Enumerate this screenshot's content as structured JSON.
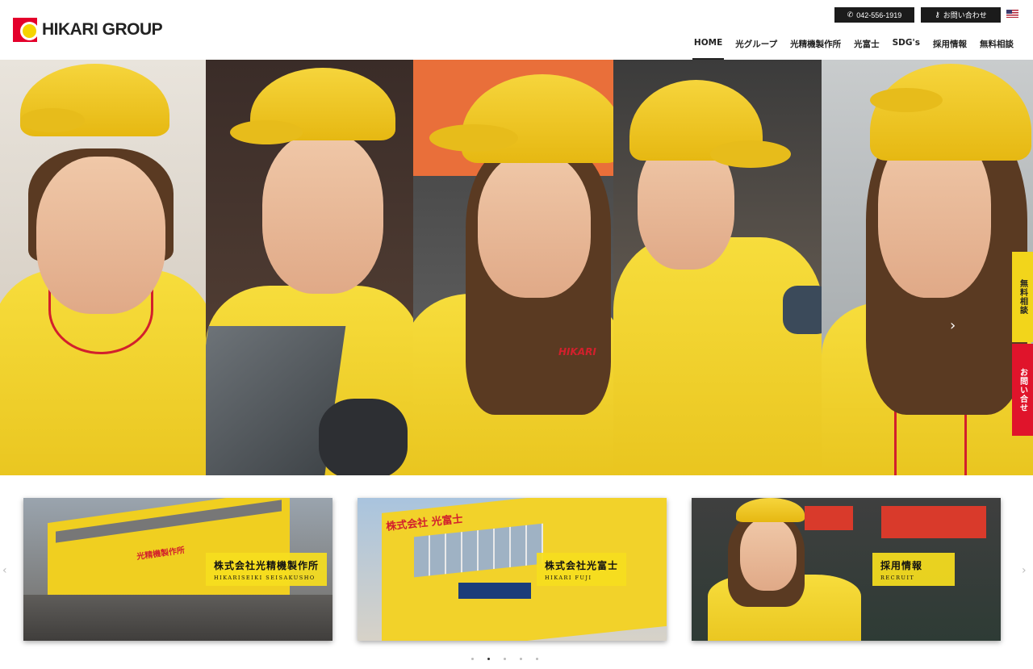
{
  "header": {
    "logo_text": "HIKARI GROUP",
    "phone": "042-556-1919",
    "contact": "お問い合わせ",
    "language_flag": "us-flag-icon",
    "nav": [
      "HOME",
      "光グループ",
      "光精機製作所",
      "光富士",
      "SDG's",
      "採用情報",
      "無料相談"
    ],
    "active_nav": "HOME"
  },
  "hero": {
    "side_tabs": [
      "無料相談",
      "お問い合せ"
    ],
    "slide_count": 6,
    "active_slide": 1,
    "next_icon": "chevron-right-icon",
    "jacket_text": "HIKARI"
  },
  "cards": [
    {
      "title": "株式会社光精機製作所",
      "subtitle": "HIKARISEIKI SEISAKUSHO",
      "sign": "光精機製作所"
    },
    {
      "title": "株式会社光富士",
      "subtitle": "HIKARI FUJI",
      "sign": "株式会社 光富士"
    },
    {
      "title": "採用情報",
      "subtitle": "RECRUIT"
    }
  ],
  "carousel": {
    "dot_count": 5,
    "active_dot": 2,
    "prev_icon": "chevron-left-icon",
    "next_icon": "chevron-right-icon"
  },
  "colors": {
    "brand_red": "#e4002b",
    "brand_yellow": "#f5d400",
    "dark": "#1b1b1b"
  }
}
